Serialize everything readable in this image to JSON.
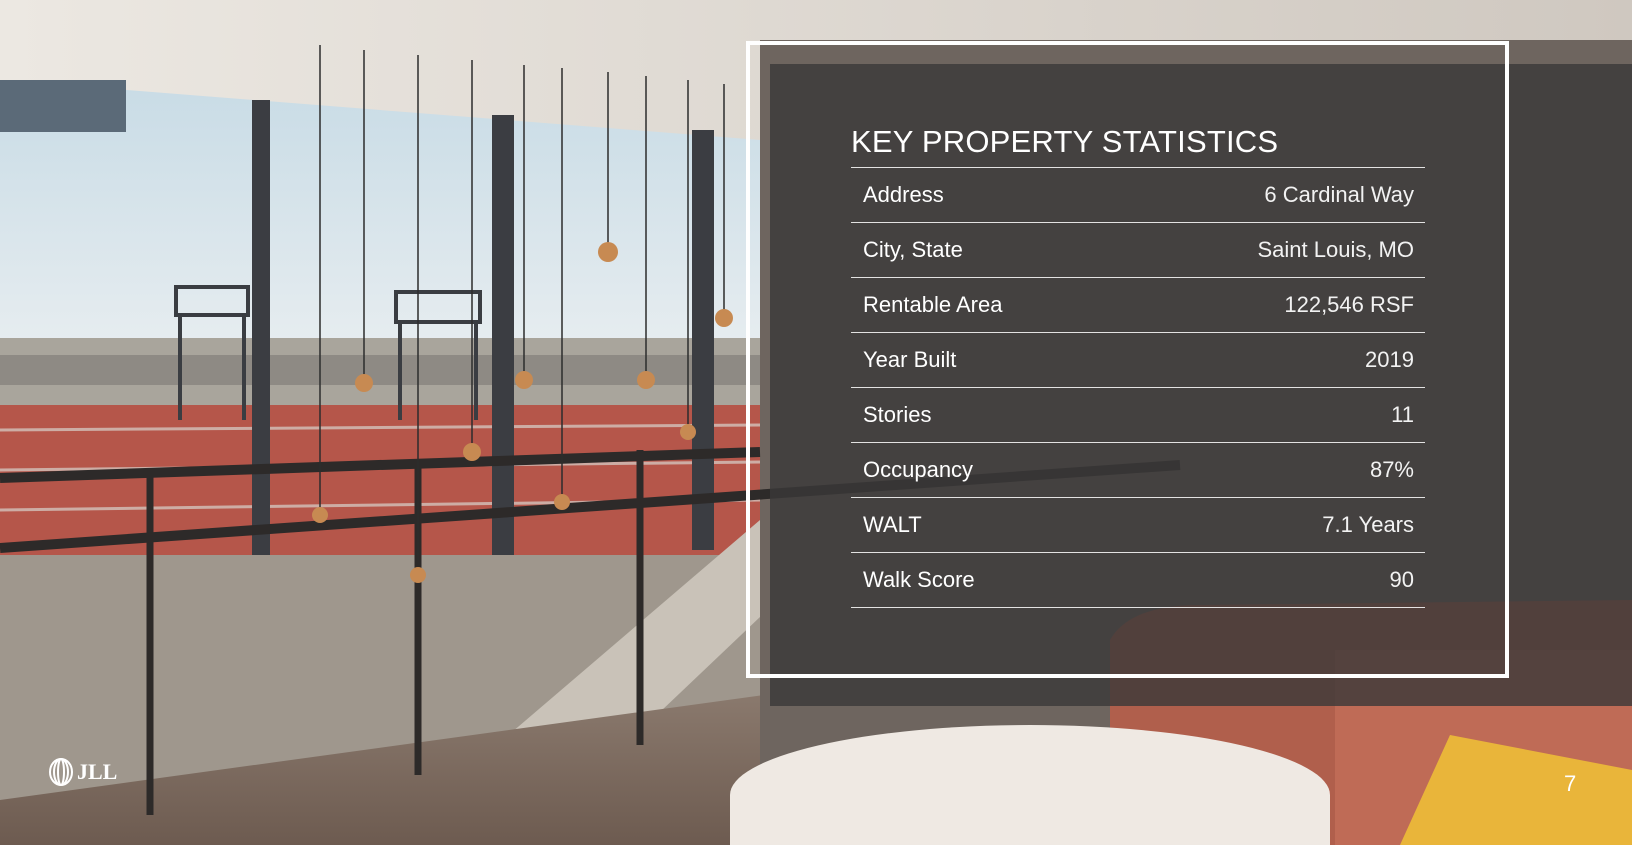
{
  "title": "KEY PROPERTY STATISTICS",
  "stats": [
    {
      "label": "Address",
      "value": "6 Cardinal Way"
    },
    {
      "label": "City, State",
      "value": "Saint Louis, MO"
    },
    {
      "label": "Rentable Area",
      "value": "122,546 RSF"
    },
    {
      "label": "Year Built",
      "value": "2019"
    },
    {
      "label": "Stories",
      "value": "11"
    },
    {
      "label": "Occupancy",
      "value": "87%"
    },
    {
      "label": "WALT",
      "value": "7.1 Years"
    },
    {
      "label": "Walk Score",
      "value": "90"
    }
  ],
  "logo_text": "JLL",
  "page_number": "7",
  "icons": {
    "logo": "jll-logo-icon"
  }
}
